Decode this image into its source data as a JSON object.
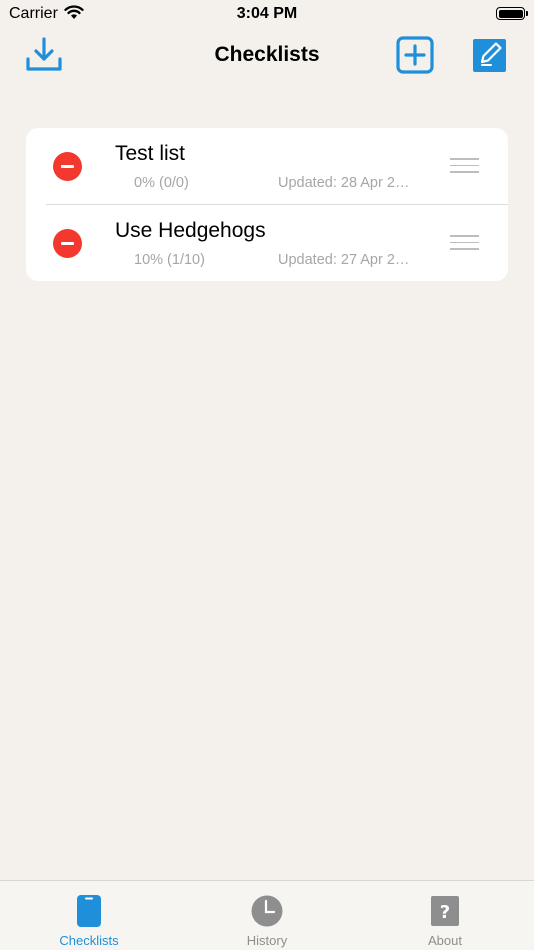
{
  "status_bar": {
    "carrier": "Carrier",
    "time": "3:04 PM"
  },
  "nav": {
    "title": "Checklists"
  },
  "checklists": [
    {
      "title": "Test list",
      "progress": "0% (0/0)",
      "updated": "Updated: 28 Apr 2…"
    },
    {
      "title": "Use Hedgehogs",
      "progress": "10% (1/10)",
      "updated": "Updated: 27 Apr 2…"
    }
  ],
  "tabs": [
    {
      "label": "Checklists",
      "icon": "phone-icon",
      "active": true
    },
    {
      "label": "History",
      "icon": "clock-icon",
      "active": false
    },
    {
      "label": "About",
      "icon": "question-icon",
      "active": false
    }
  ],
  "colors": {
    "accent": "#1e8fd8",
    "delete": "#f2382f",
    "background": "#f4f1ec"
  }
}
